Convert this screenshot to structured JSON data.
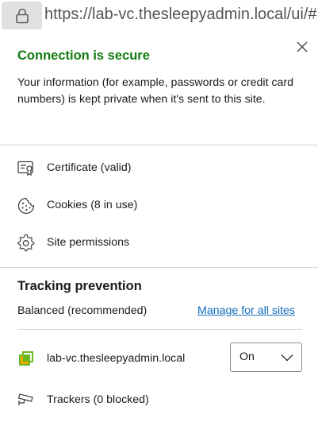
{
  "address_bar": {
    "url": "https://lab-vc.thesleepyadmin.local/ui/#",
    "lock_icon": "lock-icon"
  },
  "connection": {
    "title": "Connection is secure",
    "description": "Your information (for example, passwords or credit card numbers) is kept private when it's sent to this site.",
    "close_icon": "close-icon",
    "title_color": "#107c10"
  },
  "menu": {
    "items": [
      {
        "label": "Certificate (valid)",
        "icon": "certificate-icon"
      },
      {
        "label": "Cookies (8 in use)",
        "icon": "cookie-icon"
      },
      {
        "label": "Site permissions",
        "icon": "gear-icon"
      }
    ]
  },
  "tracking": {
    "title": "Tracking prevention",
    "level": "Balanced (recommended)",
    "manage_link": "Manage for all sites",
    "link_color": "#0f6cbd",
    "site": {
      "name": "lab-vc.thesleepyadmin.local",
      "icon": "site-favicon-icon",
      "selected": "On"
    },
    "trackers_label": "Trackers (0 blocked)",
    "trackers_icon": "tracker-camera-icon"
  }
}
